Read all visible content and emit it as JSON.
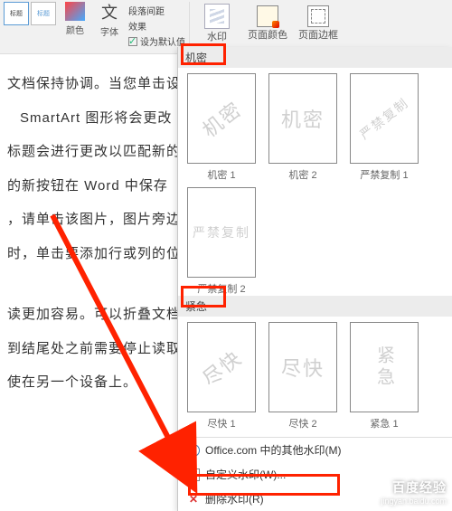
{
  "ribbon": {
    "colors_label": "颜色",
    "fonts_label": "字体",
    "opt_paragraph_spacing": "段落间距",
    "opt_effects": "效果",
    "opt_set_default": "设为默认值",
    "watermark_label": "水印",
    "page_color_label": "页面颜色",
    "page_border_label": "页面边框"
  },
  "doc": {
    "l1": "文档保持协调。当您单击设",
    "l2": "SmartArt 图形将会更改",
    "l3": "标题会进行更改以匹配新的",
    "l4": "的新按钮在 Word 中保存",
    "l5": "，请单击该图片，图片旁边",
    "l6": "时，单击要添加行或列的位",
    "l7": "读更加容易。可以折叠文档",
    "l8": "到结尾处之前需要停止读取",
    "l9": "使在另一个设备上。"
  },
  "panel": {
    "section_secret": "机密",
    "section_urgent": "紧急",
    "thumbs_secret": [
      {
        "wm": "机密",
        "label": "机密 1"
      },
      {
        "wm": "机密",
        "label": "机密 2"
      },
      {
        "wm": "严禁复制",
        "label": "严禁复制 1"
      }
    ],
    "thumb_secret_extra": {
      "wm": "严禁复制",
      "label": "严禁复制 2"
    },
    "thumbs_urgent": [
      {
        "wm": "尽快",
        "label": "尽快 1"
      },
      {
        "wm": "尽快",
        "label": "尽快 2"
      },
      {
        "wm": "紧急",
        "label": "紧急 1"
      }
    ],
    "footer": {
      "more_office": "Office.com 中的其他水印(M)",
      "custom": "自定义水印(W)...",
      "remove": "删除水印(R)"
    }
  },
  "baidu": {
    "title": "百度经验",
    "url": "jingyan.baidu.com"
  }
}
